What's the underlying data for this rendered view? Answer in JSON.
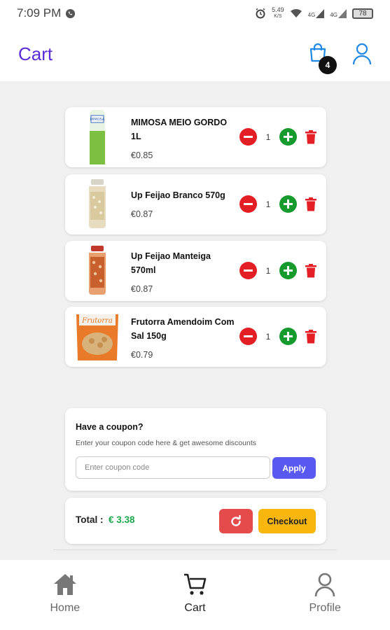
{
  "status_bar": {
    "time": "7:09 PM",
    "net_speed": "5.49",
    "net_unit": "K/S",
    "sim1": "4G",
    "sim2": "4G",
    "battery": "78"
  },
  "header": {
    "title": "Cart",
    "cart_count": "4"
  },
  "cart": {
    "items": [
      {
        "name": "MIMOSA MEIO GORDO 1L",
        "price": "€0.85",
        "qty": "1"
      },
      {
        "name": "Up Feijao Branco 570g",
        "price": "€0.87",
        "qty": "1"
      },
      {
        "name": "Up Feijao Manteiga 570ml",
        "price": "€0.87",
        "qty": "1"
      },
      {
        "name": "Frutorra Amendoim Com Sal 150g",
        "price": "€0.79",
        "qty": "1"
      }
    ]
  },
  "coupon": {
    "heading": "Have a coupon?",
    "subtext": "Enter your coupon code here & get awesome discounts",
    "placeholder": "Enter coupon code",
    "apply_label": "Apply"
  },
  "total": {
    "label": "Total :",
    "amount": "€ 3.38",
    "checkout_label": "Checkout"
  },
  "bottom_nav": {
    "items": [
      {
        "label": "Home",
        "icon": "home-icon"
      },
      {
        "label": "Cart",
        "icon": "cart-icon"
      },
      {
        "label": "Profile",
        "icon": "profile-icon"
      }
    ]
  },
  "colors": {
    "title": "#5b2dd8",
    "minus": "#e31e24",
    "plus": "#149a2d",
    "delete": "#e31e24",
    "apply": "#5959f2",
    "refresh": "#e54b4b",
    "checkout": "#f9b60c",
    "total_amount": "#1aa84a",
    "accent_icon": "#1e88e5"
  }
}
